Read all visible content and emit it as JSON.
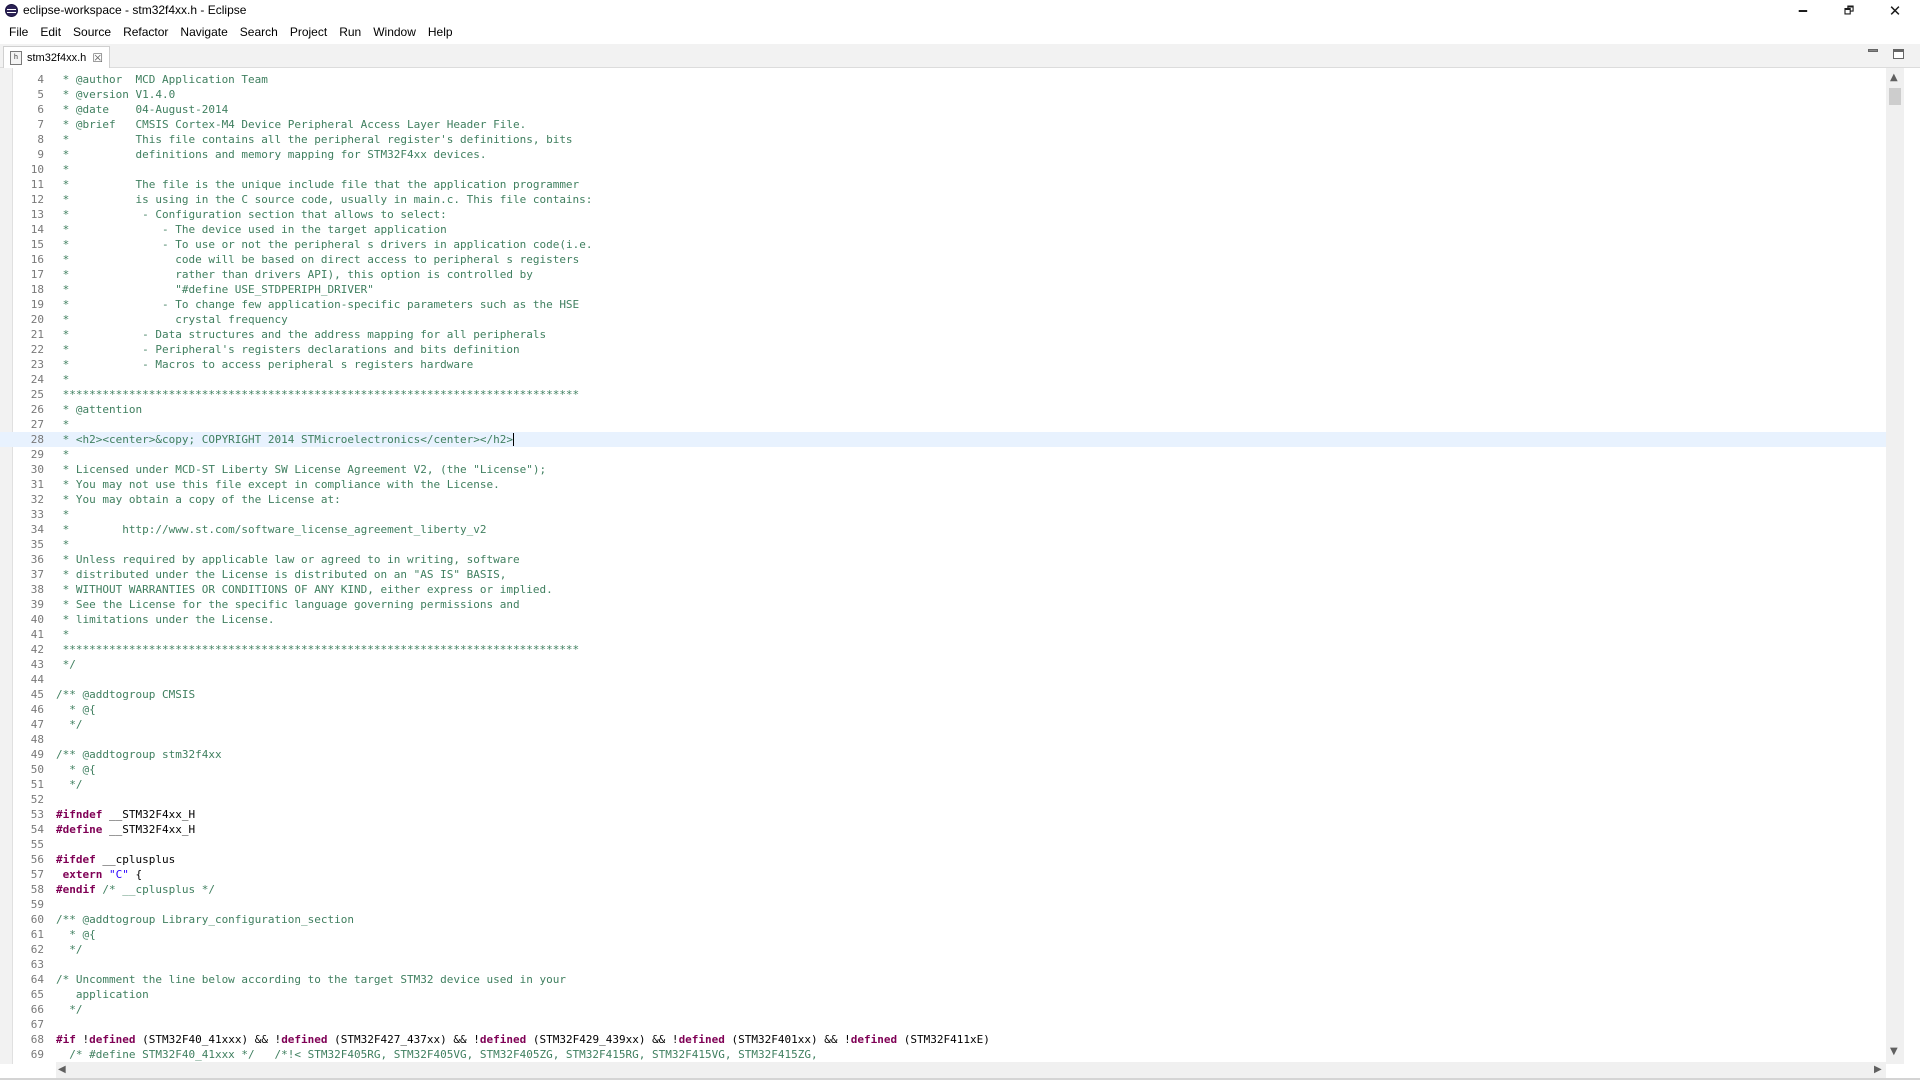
{
  "window": {
    "title": "eclipse-workspace - stm32f4xx.h - Eclipse",
    "minimize_glyph": "🗕",
    "maximize_glyph": "🗗",
    "close_glyph": "✕"
  },
  "menu": [
    "File",
    "Edit",
    "Source",
    "Refactor",
    "Navigate",
    "Search",
    "Project",
    "Run",
    "Window",
    "Help"
  ],
  "editor_tab": {
    "label": "stm32f4xx.h",
    "file_icon_glyph": "h",
    "close_glyph": "☒"
  },
  "colors": {
    "comment": "#3f7f5f",
    "keyword": "#7f0055",
    "string": "#2a00ff",
    "current_line": "#e8f2fe"
  },
  "editor": {
    "current_line": 28,
    "lines": [
      {
        "n": "4",
        "segs": [
          [
            " * @author  MCD Application Team",
            "comment"
          ]
        ]
      },
      {
        "n": "5",
        "segs": [
          [
            " * @version V1.4.0",
            "comment"
          ]
        ]
      },
      {
        "n": "6",
        "segs": [
          [
            " * @date    04-August-2014",
            "comment"
          ]
        ]
      },
      {
        "n": "7",
        "segs": [
          [
            " * @brief   CMSIS Cortex-M4 Device Peripheral Access Layer Header File.",
            "comment"
          ]
        ]
      },
      {
        "n": "8",
        "segs": [
          [
            " *          This file contains all the peripheral register's definitions, bits",
            "comment"
          ]
        ]
      },
      {
        "n": "9",
        "segs": [
          [
            " *          definitions and memory mapping for STM32F4xx devices.",
            "comment"
          ]
        ]
      },
      {
        "n": "10",
        "segs": [
          [
            " *",
            "comment"
          ]
        ]
      },
      {
        "n": "11",
        "segs": [
          [
            " *          The file is the unique include file that the application programmer",
            "comment"
          ]
        ]
      },
      {
        "n": "12",
        "segs": [
          [
            " *          is using in the C source code, usually in main.c. This file contains:",
            "comment"
          ]
        ]
      },
      {
        "n": "13",
        "segs": [
          [
            " *           - Configuration section that allows to select:",
            "comment"
          ]
        ]
      },
      {
        "n": "14",
        "segs": [
          [
            " *              - The device used in the target application",
            "comment"
          ]
        ]
      },
      {
        "n": "15",
        "segs": [
          [
            " *              - To use or not the peripherals drivers in application code(i.e.",
            "comment"
          ]
        ]
      },
      {
        "n": "16",
        "segs": [
          [
            " *                code will be based on direct access to peripherals registers",
            "comment"
          ]
        ]
      },
      {
        "n": "17",
        "segs": [
          [
            " *                rather than drivers API), this option is controlled by",
            "comment"
          ]
        ]
      },
      {
        "n": "18",
        "segs": [
          [
            " *                \"#define USE_STDPERIPH_DRIVER\"",
            "comment"
          ]
        ]
      },
      {
        "n": "19",
        "segs": [
          [
            " *              - To change few application-specific parameters such as the HSE",
            "comment"
          ]
        ]
      },
      {
        "n": "20",
        "segs": [
          [
            " *                crystal frequency",
            "comment"
          ]
        ]
      },
      {
        "n": "21",
        "segs": [
          [
            " *           - Data structures and the address mapping for all peripherals",
            "comment"
          ]
        ]
      },
      {
        "n": "22",
        "segs": [
          [
            " *           - Peripheral's registers declarations and bits definition",
            "comment"
          ]
        ]
      },
      {
        "n": "23",
        "segs": [
          [
            " *           - Macros to access peripherals registers hardware",
            "comment"
          ]
        ]
      },
      {
        "n": "24",
        "segs": [
          [
            " *",
            "comment"
          ]
        ]
      },
      {
        "n": "25",
        "segs": [
          [
            " ******************************************************************************",
            "comment"
          ]
        ]
      },
      {
        "n": "26",
        "segs": [
          [
            " * @attention",
            "comment"
          ]
        ]
      },
      {
        "n": "27",
        "segs": [
          [
            " *",
            "comment"
          ]
        ]
      },
      {
        "n": "28",
        "segs": [
          [
            " * <h2><center>&copy; COPYRIGHT 2014 STMicroelectronics</center></h2>",
            "comment"
          ]
        ]
      },
      {
        "n": "29",
        "segs": [
          [
            " *",
            "comment"
          ]
        ]
      },
      {
        "n": "30",
        "segs": [
          [
            " * Licensed under MCD-ST Liberty SW License Agreement V2, (the \"License\");",
            "comment"
          ]
        ]
      },
      {
        "n": "31",
        "segs": [
          [
            " * You may not use this file except in compliance with the License.",
            "comment"
          ]
        ]
      },
      {
        "n": "32",
        "segs": [
          [
            " * You may obtain a copy of the License at:",
            "comment"
          ]
        ]
      },
      {
        "n": "33",
        "segs": [
          [
            " *",
            "comment"
          ]
        ]
      },
      {
        "n": "34",
        "segs": [
          [
            " *        http://www.st.com/software_license_agreement_liberty_v2",
            "comment"
          ]
        ]
      },
      {
        "n": "35",
        "segs": [
          [
            " *",
            "comment"
          ]
        ]
      },
      {
        "n": "36",
        "segs": [
          [
            " * Unless required by applicable law or agreed to in writing, software",
            "comment"
          ]
        ]
      },
      {
        "n": "37",
        "segs": [
          [
            " * distributed under the License is distributed on an \"AS IS\" BASIS,",
            "comment"
          ]
        ]
      },
      {
        "n": "38",
        "segs": [
          [
            " * WITHOUT WARRANTIES OR CONDITIONS OF ANY KIND, either express or implied.",
            "comment"
          ]
        ]
      },
      {
        "n": "39",
        "segs": [
          [
            " * See the License for the specific language governing permissions and",
            "comment"
          ]
        ]
      },
      {
        "n": "40",
        "segs": [
          [
            " * limitations under the License.",
            "comment"
          ]
        ]
      },
      {
        "n": "41",
        "segs": [
          [
            " *",
            "comment"
          ]
        ]
      },
      {
        "n": "42",
        "segs": [
          [
            " ******************************************************************************",
            "comment"
          ]
        ]
      },
      {
        "n": "43",
        "segs": [
          [
            " */",
            "comment"
          ]
        ]
      },
      {
        "n": "44",
        "segs": []
      },
      {
        "n": "45",
        "segs": [
          [
            "/** @addtogroup CMSIS",
            "comment"
          ]
        ]
      },
      {
        "n": "46",
        "segs": [
          [
            "  * @{",
            "comment"
          ]
        ]
      },
      {
        "n": "47",
        "segs": [
          [
            "  */",
            "comment"
          ]
        ]
      },
      {
        "n": "48",
        "segs": []
      },
      {
        "n": "49",
        "segs": [
          [
            "/** @addtogroup stm32f4xx",
            "comment"
          ]
        ]
      },
      {
        "n": "50",
        "segs": [
          [
            "  * @{",
            "comment"
          ]
        ]
      },
      {
        "n": "51",
        "segs": [
          [
            "  */",
            "comment"
          ]
        ]
      },
      {
        "n": "52",
        "segs": []
      },
      {
        "n": "53",
        "segs": [
          [
            "#ifndef",
            "kw"
          ],
          [
            " __STM32F4xx_H",
            "plain"
          ]
        ]
      },
      {
        "n": "54",
        "segs": [
          [
            "#define",
            "kw"
          ],
          [
            " __STM32F4xx_H",
            "plain"
          ]
        ]
      },
      {
        "n": "55",
        "segs": []
      },
      {
        "n": "56",
        "segs": [
          [
            "#ifdef",
            "kw"
          ],
          [
            " __cplusplus",
            "plain"
          ]
        ]
      },
      {
        "n": "57",
        "segs": [
          [
            " extern ",
            "kw"
          ],
          [
            "\"C\"",
            "str"
          ],
          [
            " {",
            "plain"
          ]
        ]
      },
      {
        "n": "58",
        "segs": [
          [
            "#endif",
            "kw"
          ],
          [
            " /* __cplusplus */",
            "comment"
          ]
        ]
      },
      {
        "n": "59",
        "segs": []
      },
      {
        "n": "60",
        "segs": [
          [
            "/** @addtogroup Library_configuration_section",
            "comment"
          ]
        ]
      },
      {
        "n": "61",
        "segs": [
          [
            "  * @{",
            "comment"
          ]
        ]
      },
      {
        "n": "62",
        "segs": [
          [
            "  */",
            "comment"
          ]
        ]
      },
      {
        "n": "63",
        "segs": []
      },
      {
        "n": "64",
        "segs": [
          [
            "/* Uncomment the line below according to the target STM32 device used in your",
            "comment"
          ]
        ]
      },
      {
        "n": "65",
        "segs": [
          [
            "   application",
            "comment"
          ]
        ]
      },
      {
        "n": "66",
        "segs": [
          [
            "  */",
            "comment"
          ]
        ]
      },
      {
        "n": "67",
        "segs": []
      },
      {
        "n": "68",
        "segs": [
          [
            "#if",
            "kw"
          ],
          [
            " !",
            "plain"
          ],
          [
            "defined",
            "kw"
          ],
          [
            " (STM32F40_41xxx) && !",
            "plain"
          ],
          [
            "defined",
            "kw"
          ],
          [
            " (STM32F427_437xx) && !",
            "plain"
          ],
          [
            "defined",
            "kw"
          ],
          [
            " (STM32F429_439xx) && !",
            "plain"
          ],
          [
            "defined",
            "kw"
          ],
          [
            " (STM32F401xx) && !",
            "plain"
          ],
          [
            "defined",
            "kw"
          ],
          [
            " (STM32F411xE)",
            "plain"
          ]
        ]
      },
      {
        "n": "69",
        "segs": [
          [
            "  /* #define STM32F40_41xxx */   /*!< STM32F405RG, STM32F405VG, STM32F405ZG, STM32F415RG, STM32F415VG, STM32F415ZG,",
            "comment"
          ]
        ]
      }
    ]
  },
  "scroll_arrows": {
    "up": "▲",
    "down": "▼",
    "left": "◀",
    "right": "▶"
  }
}
